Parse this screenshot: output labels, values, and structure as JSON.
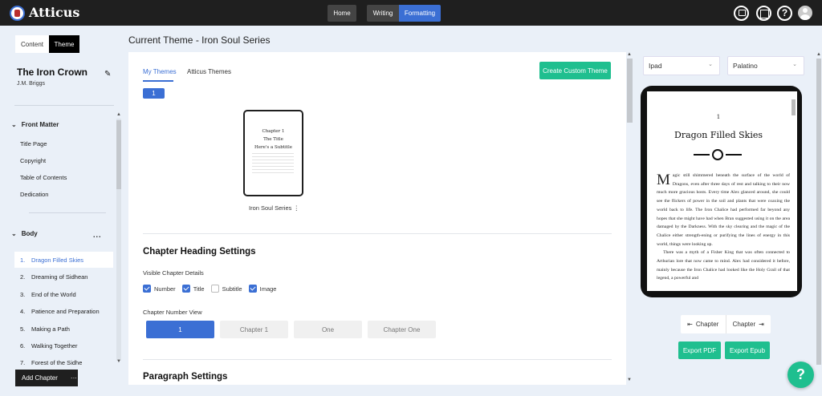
{
  "app": {
    "brand": "Atticus"
  },
  "topnav": {
    "home": "Home",
    "writing": "Writing",
    "formatting": "Formatting",
    "help_glyph": "?"
  },
  "sidebar": {
    "tabs": {
      "content": "Content",
      "theme": "Theme"
    },
    "book": {
      "title": "The Iron Crown",
      "author": "J.M. Briggs"
    },
    "front_matter": {
      "heading": "Front Matter",
      "items": [
        "Title Page",
        "Copyright",
        "Table of Contents",
        "Dedication"
      ]
    },
    "body": {
      "heading": "Body",
      "more": "...",
      "chapters": [
        {
          "num": "1.",
          "label": "Dragon Filled Skies"
        },
        {
          "num": "2.",
          "label": "Dreaming of Sidhean"
        },
        {
          "num": "3.",
          "label": "End of the World"
        },
        {
          "num": "4.",
          "label": "Patience and Preparation"
        },
        {
          "num": "5.",
          "label": "Making a Path"
        },
        {
          "num": "6.",
          "label": "Walking Together"
        },
        {
          "num": "7.",
          "label": "Forest of the Sidhe"
        }
      ]
    },
    "add_chapter": "Add Chapter",
    "add_chapter_more": "···"
  },
  "main": {
    "current_theme": "Current Theme - Iron Soul Series",
    "tabs": {
      "my_themes": "My Themes",
      "atticus_themes": "Atticus Themes"
    },
    "create_button": "Create Custom Theme",
    "page_number": "1",
    "theme_card": {
      "line1": "Chapter 1",
      "line2": "The Title",
      "line3": "Here's a Subtitle",
      "name": "Iron Soul Series ⋮"
    },
    "chapter_heading": {
      "title": "Chapter Heading Settings",
      "visible_label": "Visible Chapter Details",
      "checks": [
        {
          "label": "Number",
          "checked": true
        },
        {
          "label": "Title",
          "checked": true
        },
        {
          "label": "Subtitle",
          "checked": false
        },
        {
          "label": "Image",
          "checked": true
        }
      ],
      "number_view_label": "Chapter Number View",
      "number_views": [
        "1",
        "Chapter 1",
        "One",
        "Chapter One"
      ]
    },
    "paragraph": {
      "title": "Paragraph Settings"
    }
  },
  "preview": {
    "device_select": "Ipad",
    "font_select": "Palatino",
    "chapter_number": "1",
    "chapter_title": "Dragon Filled Skies",
    "drop_cap": "M",
    "body_text": "agic still shimmered beneath the surface of the world of Dragons, even after three days of rest and talking to their now much more gracious hosts. Every time Alex glanced around, she could see the flickers of power in the soil and plants that were coaxing the world back to life. The Iron Chalice had performed far beyond any hopes that she might have had when Bran suggested using it on the area damaged by the Darkness. With the sky clearing and the magic of the Chalice either strength-ening or purifying the lines of energy in this world, things were looking up.",
    "body_text_2": "There was a myth of a Fisher King that was often connected to Arthurian lore that now came to mind. Alex had considered it before, mainly because the Iron Chalice had looked like the Holy Grail of that legend, a powerful and",
    "prev_chapter": "Chapter",
    "next_chapter": "Chapter",
    "export_pdf": "Export PDF",
    "export_epub": "Export Epub"
  },
  "colors": {
    "accent": "#3b6fd4",
    "green": "#1fbf8f",
    "topbar": "#1f1f1f"
  }
}
